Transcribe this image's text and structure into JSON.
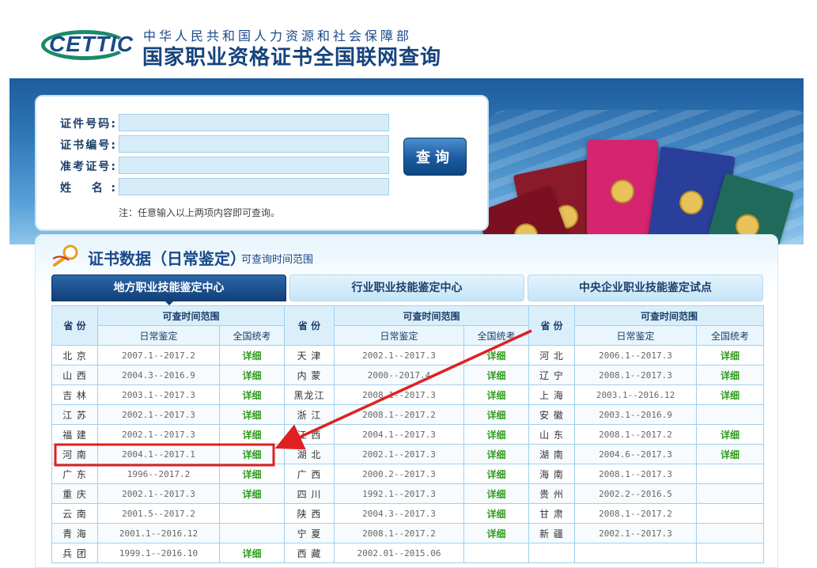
{
  "header": {
    "logo_text": "CETTIC",
    "org_name": "中华人民共和国人力资源和社会保障部",
    "site_title": "国家职业资格证书全国联网查询"
  },
  "query": {
    "fields": [
      {
        "label": "证件号码:",
        "value": ""
      },
      {
        "label": "证书编号:",
        "value": ""
      },
      {
        "label": "准考证号:",
        "value": ""
      },
      {
        "label": "姓 名:",
        "value": ""
      }
    ],
    "button_label": "查询",
    "note": "注：任意输入以上两项内容即可查询。"
  },
  "data_panel": {
    "title": "证书数据（日常鉴定）",
    "subtitle": "可查询时间范围",
    "tabs": [
      {
        "label": "地方职业技能鉴定中心",
        "active": true
      },
      {
        "label": "行业职业技能鉴定中心",
        "active": false
      },
      {
        "label": "中央企业职业技能鉴定试点",
        "active": false
      }
    ]
  },
  "table": {
    "headers": {
      "province": "省 份",
      "range": "可查时间范围",
      "daily": "日常鉴定",
      "national": "全国统考"
    },
    "rows": [
      [
        {
          "p": "北 京",
          "r": "2007.1--2017.2",
          "d": "详细"
        },
        {
          "p": "天 津",
          "r": "2002.1--2017.3",
          "d": "详细"
        },
        {
          "p": "河 北",
          "r": "2006.1--2017.3",
          "d": "详细"
        }
      ],
      [
        {
          "p": "山 西",
          "r": "2004.3--2016.9",
          "d": "详细"
        },
        {
          "p": "内 蒙",
          "r": "2000--2017.4",
          "d": "详细"
        },
        {
          "p": "辽 宁",
          "r": "2008.1--2017.3",
          "d": "详细"
        }
      ],
      [
        {
          "p": "吉 林",
          "r": "2003.1--2017.3",
          "d": "详细"
        },
        {
          "p": "黑龙江",
          "r": "2008.1--2017.3",
          "d": "详细"
        },
        {
          "p": "上 海",
          "r": "2003.1--2016.12",
          "d": "详细"
        }
      ],
      [
        {
          "p": "江 苏",
          "r": "2002.1--2017.3",
          "d": "详细"
        },
        {
          "p": "浙 江",
          "r": "2008.1--2017.2",
          "d": "详细"
        },
        {
          "p": "安 徽",
          "r": "2003.1--2016.9",
          "d": ""
        }
      ],
      [
        {
          "p": "福 建",
          "r": "2002.1--2017.3",
          "d": "详细"
        },
        {
          "p": "江 西",
          "r": "2004.1--2017.3",
          "d": "详细"
        },
        {
          "p": "山 东",
          "r": "2008.1--2017.2",
          "d": "详细"
        }
      ],
      [
        {
          "p": "河 南",
          "r": "2004.1--2017.1",
          "d": "详细"
        },
        {
          "p": "湖 北",
          "r": "2002.1--2017.3",
          "d": "详细"
        },
        {
          "p": "湖 南",
          "r": "2004.6--2017.3",
          "d": "详细"
        }
      ],
      [
        {
          "p": "广 东",
          "r": "1996--2017.2",
          "d": "详细"
        },
        {
          "p": "广 西",
          "r": "2000.2--2017.3",
          "d": "详细"
        },
        {
          "p": "海 南",
          "r": "2008.1--2017.3",
          "d": ""
        }
      ],
      [
        {
          "p": "重 庆",
          "r": "2002.1--2017.3",
          "d": "详细"
        },
        {
          "p": "四 川",
          "r": "1992.1--2017.3",
          "d": "详细"
        },
        {
          "p": "贵 州",
          "r": "2002.2--2016.5",
          "d": ""
        }
      ],
      [
        {
          "p": "云 南",
          "r": "2001.5--2017.2",
          "d": ""
        },
        {
          "p": "陕 西",
          "r": "2004.3--2017.3",
          "d": "详细"
        },
        {
          "p": "甘 肃",
          "r": "2008.1--2017.2",
          "d": ""
        }
      ],
      [
        {
          "p": "青 海",
          "r": "2001.1--2016.12",
          "d": ""
        },
        {
          "p": "宁 夏",
          "r": "2008.1--2017.2",
          "d": "详细"
        },
        {
          "p": "新 疆",
          "r": "2002.1--2017.3",
          "d": ""
        }
      ],
      [
        {
          "p": "兵 团",
          "r": "1999.1--2016.10",
          "d": "详细"
        },
        {
          "p": "西 藏",
          "r": "2002.01--2015.06",
          "d": ""
        },
        {
          "p": "",
          "r": "",
          "d": ""
        }
      ]
    ]
  },
  "colors": {
    "brand_blue": "#1a4a8a",
    "detail_green": "#2f9a1d",
    "annotation_red": "#e02020"
  }
}
